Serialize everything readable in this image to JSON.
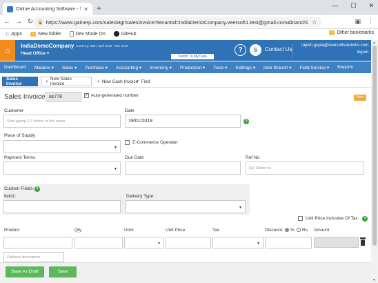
{
  "browser": {
    "tab_title": "Online Accounting Software - Sa",
    "url": "https://www.gainerp.com/salesMgr/salesinvoice?tenantId=IndiaDemoCompany.veersoft1.test@gmail.com&branchl...",
    "bookmarks": [
      "Apps",
      "New folder",
      "Dev Mode On",
      "GitHub"
    ],
    "other_bookmarks": "Other bookmarks"
  },
  "header": {
    "company": "IndiaDemoCompany",
    "branch": "Head Office",
    "currency_info": "Currency: INR | April 2018 - Mar 2019",
    "switch_data": "Switch To My Data",
    "contact": "Contact Us",
    "user_email": "rajesh.gupta@veersoftsolutions.com",
    "logout": "logout",
    "accent": "#2f72b6",
    "home_color": "#f08c1c"
  },
  "menu": [
    "Dashboard",
    "Masters",
    "Sales",
    "Purchase",
    "Accounting",
    "Inventory",
    "Production",
    "Tools",
    "Settings",
    "Inter Branch",
    "Field Service",
    "Reports"
  ],
  "tabs": {
    "active": "Sales Invoice",
    "new_sales": "New Sales Invoice",
    "new_cash": "New Cash Invoice",
    "find": "Find"
  },
  "form": {
    "invoice_label": "Sales Invoice:",
    "invoice_number": "as778",
    "auto_generated": "Auto-generated number",
    "new_badge": "New",
    "customer_label": "Customer",
    "customer_placeholder": "Start typing 2-3 letters of the name",
    "date_label": "Date",
    "date_value": "19/01/2019",
    "place_of_supply_label": "Place of Supply",
    "ecommerce_label": "E-Commerce Operater",
    "payment_terms_label": "Payment Terms",
    "due_date_label": "Due Date",
    "ref_no_label": "Ref No",
    "ref_no_placeholder": "Eg: Order no.",
    "custom_fields_label": "Custom Fields:",
    "field1_label": "field1:",
    "delivery_type_label": "Delivery Type:",
    "unit_price_inclusive": "Unit Price Inclusive Of Tax"
  },
  "line_items": {
    "headers": {
      "product": "Product",
      "qty": "Qty",
      "uom": "Uom",
      "unit_price": "Unit Price",
      "tax": "Tax",
      "discount": "Discount",
      "percent": "%",
      "rs": "Rs.",
      "amount": "Amount"
    },
    "desc_placeholder": "Optional description"
  },
  "footer": {
    "save_draft": "Save As Draft",
    "save": "Save"
  }
}
